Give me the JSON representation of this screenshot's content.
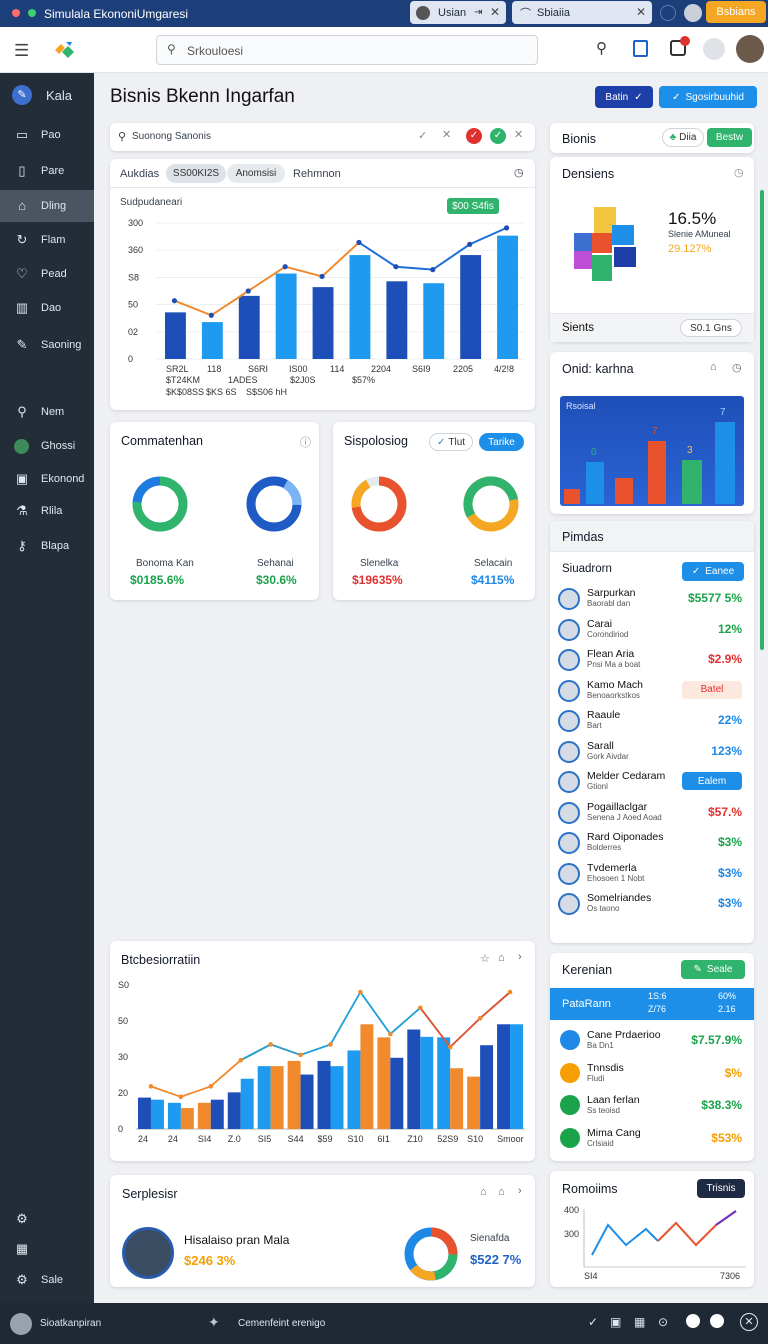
{
  "window": {
    "title": "Simulala EkononiUmgaresi",
    "tab1": "Usian",
    "tab2": "Sbiaiia",
    "user_badge": "Bsbians"
  },
  "search": {
    "placeholder": "Srkouloesi"
  },
  "sidebar": {
    "workspace": "Kala",
    "items": [
      {
        "label": "Pao",
        "icon": "folder-icon"
      },
      {
        "label": "Pare",
        "icon": "document-icon"
      },
      {
        "label": "Dling",
        "icon": "home-icon"
      },
      {
        "label": "Flam",
        "icon": "refresh-icon"
      },
      {
        "label": "Pead",
        "icon": "heart-icon"
      },
      {
        "label": "Dao",
        "icon": "columns-icon"
      },
      {
        "label": "Saoning",
        "icon": "pen-icon"
      },
      {
        "label": "Nem",
        "icon": "search-icon"
      },
      {
        "label": "Ghossi",
        "icon": "globe-icon"
      },
      {
        "label": "Ekonond",
        "icon": "calendar-icon"
      },
      {
        "label": "Rlila",
        "icon": "flask-icon"
      },
      {
        "label": "Blapa",
        "icon": "key-icon"
      }
    ],
    "footer": [
      {
        "icon": "settings-icon"
      },
      {
        "icon": "calendar-icon"
      },
      {
        "label": "Sale",
        "icon": "gear-icon"
      }
    ]
  },
  "page": {
    "title": "Bisnis Bkenn Ingarfan",
    "btn1": "Batin",
    "btn2": "Sgosirbuuhid"
  },
  "filter": {
    "placeholder": "Suonong Sanonis"
  },
  "main_chart": {
    "tabs": [
      "Aukdias",
      "SS00KI2S",
      "Anomsisi",
      "Rehmnon"
    ],
    "subtitle": "Sudpudaneari",
    "badge": "$00 S4fis",
    "yticks": [
      "300",
      "360",
      "S8",
      "50",
      "02",
      "0"
    ],
    "xlabels": [
      "SR2L",
      "118",
      "S6RI",
      "IS00",
      "114",
      "2204",
      "S6I9",
      "2205",
      "4/2!8"
    ],
    "xlabels2": [
      "$T24KM",
      "1ADES",
      "$2J0S",
      "$57%"
    ],
    "xlabels3": [
      "$K$08SS",
      "$KS 6S",
      "S$S06 hH"
    ]
  },
  "chart_data": [
    {
      "type": "bar",
      "title": "",
      "categories": [
        "SR2L",
        "118",
        "S6RI",
        "IS00",
        "114",
        "2204",
        "S6I9",
        "2205",
        "4/2!8"
      ],
      "series": [
        {
          "values": [
            48,
            38,
            65,
            88,
            74,
            107,
            80,
            78,
            107,
            127
          ]
        },
        {
          "values": [
            60,
            45,
            70,
            95,
            85,
            120,
            95,
            92,
            118,
            135
          ]
        }
      ]
    },
    {
      "type": "bar",
      "categories": [
        "24",
        "24",
        "SI4",
        "Z.0",
        "SI5",
        "S44",
        "$59",
        "S10",
        "6I1",
        "Z10",
        "52S9",
        "S10",
        "Smoor"
      ],
      "series": [
        {
          "values": [
            12,
            10,
            10,
            14,
            24,
            26,
            26,
            30,
            35,
            38,
            35,
            20,
            40
          ]
        },
        {
          "values": [
            14,
            10,
            14,
            24,
            30,
            26,
            30,
            50,
            34,
            44,
            29,
            40,
            50
          ]
        }
      ]
    }
  ],
  "donuts_left": {
    "title": "Commatenhan",
    "items": [
      {
        "label": "Bonoma Kan",
        "value": "$0185.6%"
      },
      {
        "label": "Sehanai",
        "value": "$30.6%"
      }
    ]
  },
  "donuts_right": {
    "title": "Sispolosiog",
    "btn1": "Tlut",
    "btn2": "Tarike",
    "items": [
      {
        "label": "Slenelka",
        "value": "$19635%"
      },
      {
        "label": "Selacain",
        "value": "$4115%"
      }
    ]
  },
  "bottom_chart": {
    "title": "Btcbesiorratiin",
    "yticks": [
      "S0",
      "50",
      "30",
      "20",
      "0"
    ]
  },
  "profile": {
    "title": "Serplesisr",
    "name": "Hisalaiso pran Mala",
    "value": "$246 3%",
    "right_label": "Sienafda",
    "right_value": "$522 7%"
  },
  "right": {
    "bisnis": {
      "title": "Bionis",
      "btn1": "Diia",
      "btn2": "Bestw"
    },
    "densiens": {
      "title": "Densiens",
      "pct": "16.5%",
      "sub": "Slenie AMuneal",
      "sub2": "29.127%",
      "footer": "Sients",
      "footer_btn": "S0.1 Gns"
    },
    "onid": {
      "title": "Onid: karhna",
      "subtitle": "Rsoisal",
      "labels": [
        "0",
        "7",
        "3",
        "7"
      ]
    },
    "pimdas": {
      "title": "Pimdas",
      "sub": "Siuadrorn",
      "btn": "Eanee",
      "rows": [
        {
          "name": "Sarpurkan",
          "sub": "Baorabl dan",
          "value": "$5577 5%",
          "color": "#1aa34a"
        },
        {
          "name": "Carai",
          "sub": "Corondiriod",
          "value": "12%",
          "color": "#1aa34a"
        },
        {
          "name": "Flean Aria",
          "sub": "Pnsi Ma a boat",
          "value": "$2.9%",
          "color": "#e03131"
        },
        {
          "name": "Kamo Mach",
          "sub": "Benoaorkstkos",
          "value": "Batel",
          "color": "#e03131"
        },
        {
          "name": "Raaule",
          "sub": "Bart",
          "value": "22%",
          "color": "#1e88e5"
        },
        {
          "name": "Sarall",
          "sub": "Gork Aivdar",
          "value": "123%",
          "color": "#1e88e5"
        },
        {
          "name": "Melder Cedaram",
          "sub": "Gtionl",
          "value": "Ealem",
          "color": "#1e88e5"
        },
        {
          "name": "Pogaillaclgar",
          "sub": "Senena J Aoed Aoad",
          "value": "$57.%",
          "color": "#e03131"
        },
        {
          "name": "Rard Oiponades",
          "sub": "Bolderres",
          "value": "$3%",
          "color": "#1aa34a"
        },
        {
          "name": "Tvdemerla",
          "sub": "Ehosoen 1 Nobt",
          "value": "$3%",
          "color": "#1e88e5"
        },
        {
          "name": "Somelriandes",
          "sub": "Os taono",
          "value": "$3%",
          "color": "#1e88e5"
        }
      ]
    },
    "kerenian": {
      "title": "Kerenian",
      "btn": "Seale",
      "header": "PataRann",
      "h2": "1S:6",
      "h3": "60%",
      "h4": "Z/76",
      "h5": "2.16",
      "rows": [
        {
          "name": "Cane Prdaerioo",
          "sub": "Ba Dn1",
          "value": "$7.57.9%",
          "color": "#1aa34a",
          "ic": "#1e88e5"
        },
        {
          "name": "Tnnsdis",
          "sub": "Fludi",
          "value": "$%",
          "color": "#f59f00",
          "ic": "#f59f00"
        },
        {
          "name": "Laan ferlan",
          "sub": "Ss teoisd",
          "value": "$38.3%",
          "color": "#1aa34a",
          "ic": "#1aa34a"
        },
        {
          "name": "Mima Cang",
          "sub": "Crlsiaid",
          "value": "$53%",
          "color": "#f59f00",
          "ic": "#1aa34a"
        }
      ]
    },
    "romoiims": {
      "title": "Romoiims",
      "btn": "Trisnis",
      "yticks": [
        "400",
        "300"
      ],
      "x1": "SI4",
      "x2": "7306"
    }
  },
  "bottombar": {
    "left": "Sioatkanpiran",
    "mid": "Cemenfeint erenigo"
  }
}
